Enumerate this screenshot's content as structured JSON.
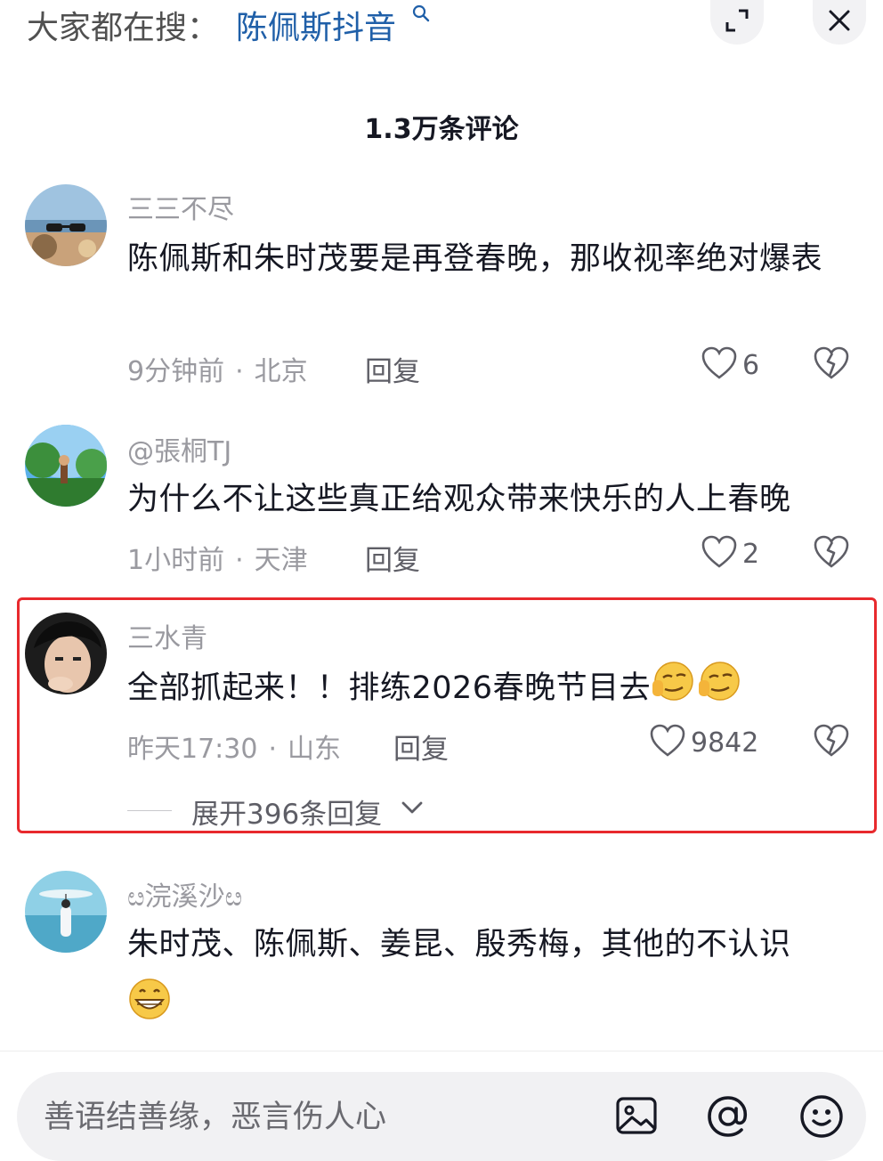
{
  "header": {
    "hot_search_prefix": "大家都在搜：",
    "hot_search_term": "陈佩斯抖音",
    "comments_title": "1.3万条评论"
  },
  "comments": [
    {
      "username": "三三不尽",
      "content": "陈佩斯和朱时茂要是再登春晚，那收视率绝对爆表",
      "time": "9分钟前",
      "location": "北京",
      "reply_label": "回复",
      "likes": "6"
    },
    {
      "username": "@張桐TJ",
      "content": "为什么不让这些真正给观众带来快乐的人上春晚",
      "time": "1小时前",
      "location": "天津",
      "reply_label": "回复",
      "likes": "2"
    },
    {
      "username": "三水青",
      "content": "全部抓起来！！排练2026春晚节目去",
      "time": "昨天17:30",
      "location": "山东",
      "reply_label": "回复",
      "likes": "9842",
      "expand_label": "展开396条回复"
    },
    {
      "username": "ೞ浣溪沙ೞ",
      "content": "朱时茂、陈佩斯、姜昆、殷秀梅，其他的不认识"
    }
  ],
  "composer": {
    "placeholder": "善语结善缘，恶言伤人心"
  },
  "icons": [
    "search-icon",
    "expand-icon",
    "close-icon",
    "heart-icon",
    "broken-heart-icon",
    "chevron-down-icon",
    "image-icon",
    "at-icon",
    "emoji-icon"
  ],
  "colors": {
    "link_blue": "#1f5fa8",
    "highlight_red": "#e8292d",
    "muted_text": "#9a9aa0"
  }
}
